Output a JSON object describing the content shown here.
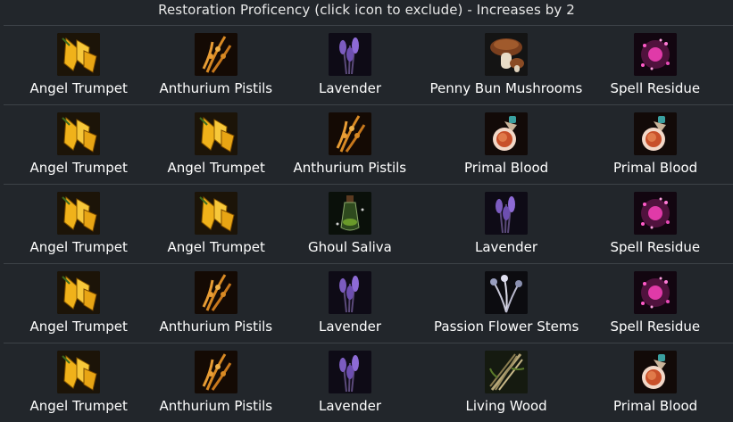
{
  "header": {
    "title": "Restoration Proficency (click icon to exclude) - Increases by 2"
  },
  "rows": [
    {
      "items": [
        {
          "label": "Angel Trumpet",
          "icon": "angel-trumpet-icon"
        },
        {
          "label": "Anthurium Pistils",
          "icon": "anthurium-pistils-icon"
        },
        {
          "label": "Lavender",
          "icon": "lavender-icon"
        },
        {
          "label": "Penny Bun Mushrooms",
          "icon": "penny-bun-mushrooms-icon"
        },
        {
          "label": "Spell Residue",
          "icon": "spell-residue-icon"
        }
      ]
    },
    {
      "items": [
        {
          "label": "Angel Trumpet",
          "icon": "angel-trumpet-icon"
        },
        {
          "label": "Angel Trumpet",
          "icon": "angel-trumpet-icon"
        },
        {
          "label": "Anthurium Pistils",
          "icon": "anthurium-pistils-icon"
        },
        {
          "label": "Primal Blood",
          "icon": "primal-blood-icon"
        },
        {
          "label": "Primal Blood",
          "icon": "primal-blood-icon"
        }
      ]
    },
    {
      "items": [
        {
          "label": "Angel Trumpet",
          "icon": "angel-trumpet-icon"
        },
        {
          "label": "Angel Trumpet",
          "icon": "angel-trumpet-icon"
        },
        {
          "label": "Ghoul Saliva",
          "icon": "ghoul-saliva-icon"
        },
        {
          "label": "Lavender",
          "icon": "lavender-icon"
        },
        {
          "label": "Spell Residue",
          "icon": "spell-residue-icon"
        }
      ]
    },
    {
      "items": [
        {
          "label": "Angel Trumpet",
          "icon": "angel-trumpet-icon"
        },
        {
          "label": "Anthurium Pistils",
          "icon": "anthurium-pistils-icon"
        },
        {
          "label": "Lavender",
          "icon": "lavender-icon"
        },
        {
          "label": "Passion Flower Stems",
          "icon": "passion-flower-stems-icon"
        },
        {
          "label": "Spell Residue",
          "icon": "spell-residue-icon"
        }
      ]
    },
    {
      "items": [
        {
          "label": "Angel Trumpet",
          "icon": "angel-trumpet-icon"
        },
        {
          "label": "Anthurium Pistils",
          "icon": "anthurium-pistils-icon"
        },
        {
          "label": "Lavender",
          "icon": "lavender-icon"
        },
        {
          "label": "Living Wood",
          "icon": "living-wood-icon"
        },
        {
          "label": "Primal Blood",
          "icon": "primal-blood-icon"
        }
      ]
    }
  ]
}
